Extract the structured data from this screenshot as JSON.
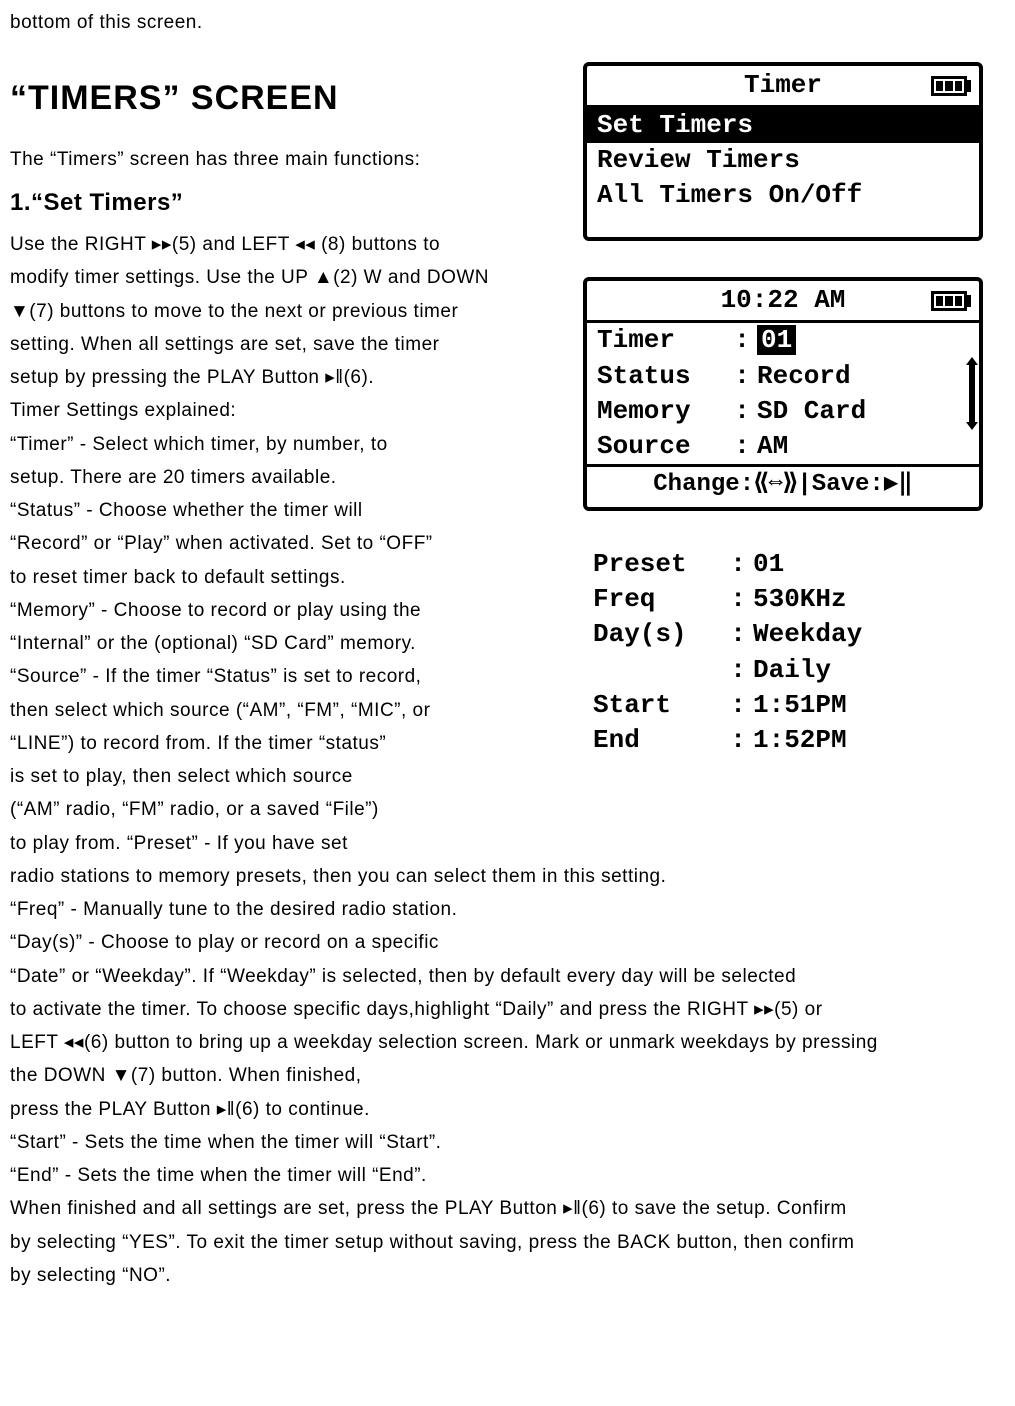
{
  "intro_tail": "bottom of this screen.",
  "heading": "“TIMERS” SCREEN",
  "line_functions": "The “Timers” screen has three main functions:",
  "sub_heading": "1.“Set Timers”",
  "body_paragraphs": [
    "Use the RIGHT ▸▸(5) and LEFT ◂◂ (8) buttons to",
    "modify timer settings. Use the UP ▲(2) W and DOWN",
    "▼(7) buttons to move to the next or previous timer",
    "setting. When all settings are set, save the timer",
    "setup by pressing the PLAY Button ▸‖(6).",
    "Timer Settings explained:",
    "“Timer” - Select which timer, by number, to",
    "setup. There are 20 timers available.",
    "“Status” - Choose whether the timer will",
    "“Record” or “Play” when activated. Set to “OFF”",
    "to reset timer back to default settings.",
    "“Memory” - Choose to record or play using the",
    "“Internal” or the (optional) “SD Card” memory.",
    "“Source” - If the timer “Status” is set to record,",
    "then select which source (“AM”, “FM”, “MIC”, or",
    "“LINE”) to record from. If the timer “status”",
    " is set to play, then select which source",
    "(“AM” radio, “FM” radio, or a saved “File”)",
    "to play from. “Preset” - If you have set"
  ],
  "body_full": [
    "radio stations to memory presets, then you can select them in this setting.",
    "“Freq” - Manually tune to the desired radio station.",
    "“Day(s)” - Choose to play or record on a specific",
    "“Date” or “Weekday”. If “Weekday” is selected, then by default every day will be selected",
    "to activate the timer. To choose specific days,highlight “Daily” and press the RIGHT ▸▸(5) or",
    "LEFT ◂◂(6)  button to bring up a weekday selection screen. Mark or unmark weekdays by pressing",
    "the DOWN ▼(7) button. When finished,",
    "press the PLAY Button ▸‖(6) to continue.",
    "“Start” - Sets the time when the timer will “Start”.",
    "“End” - Sets the time when the timer will “End”.",
    "When finished and all settings are set, press the PLAY Button ▸‖(6) to save the setup. Confirm",
    "by selecting “YES”. To exit the timer setup without saving, press the BACK button, then confirm",
    "by selecting “NO”."
  ],
  "lcd1": {
    "title": "Timer",
    "items": [
      "Set Timers",
      "Review Timers",
      "All Timers On/Off"
    ],
    "selected_index": 0
  },
  "lcd2": {
    "clock": "10:22 AM",
    "rows": [
      {
        "k": "Timer",
        "v": "01",
        "sel": true
      },
      {
        "k": "Status",
        "v": "Record"
      },
      {
        "k": "Memory",
        "v": "SD Card"
      },
      {
        "k": "Source",
        "v": "AM"
      }
    ],
    "footer": "Change:⟪⇔⟫|Save:▶‖"
  },
  "lcd3": {
    "rows": [
      {
        "k": "Preset",
        "v": "01"
      },
      {
        "k": "Freq",
        "v": " 530KHz"
      },
      {
        "k": "Day(s)",
        "v": "Weekday"
      },
      {
        "k": "",
        "v": "Daily"
      },
      {
        "k": "Start",
        "v": " 1:51PM"
      },
      {
        "k": "End",
        "v": " 1:52PM"
      }
    ]
  }
}
